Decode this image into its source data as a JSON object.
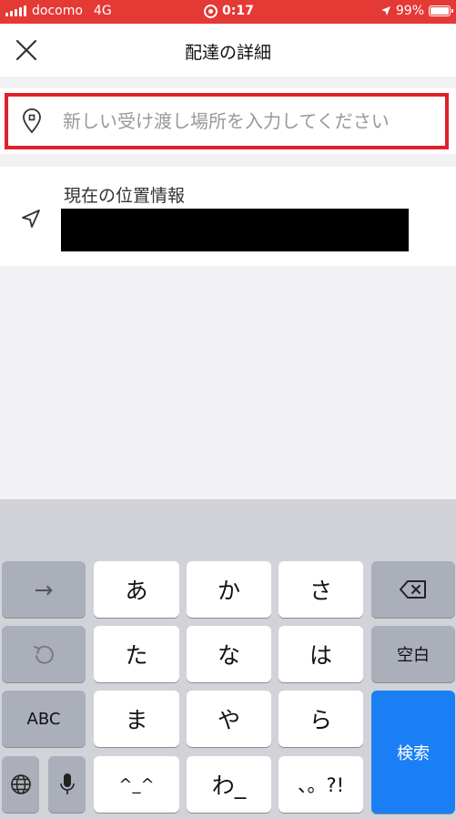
{
  "status_bar": {
    "carrier": "docomo",
    "network": "4G",
    "time": "0:17",
    "battery": "99%",
    "battery_level": 0.99
  },
  "header": {
    "title": "配達の詳細"
  },
  "search": {
    "placeholder": "新しい受け渡し場所を入力してください"
  },
  "current_location": {
    "label": "現在の位置情報"
  },
  "keyboard": {
    "arrow": "→",
    "keys_row1": [
      "あ",
      "か",
      "さ"
    ],
    "keys_row2": [
      "た",
      "な",
      "は"
    ],
    "space": "空白",
    "abc": "ABC",
    "keys_row3": [
      "ま",
      "や",
      "ら"
    ],
    "search": "検索",
    "emoticon": "^_^",
    "wa": "わ_",
    "punct": "、。?!"
  },
  "colors": {
    "status_bar": "#e53935",
    "highlight_border": "#e0202b",
    "search_key": "#1a7ff5"
  }
}
